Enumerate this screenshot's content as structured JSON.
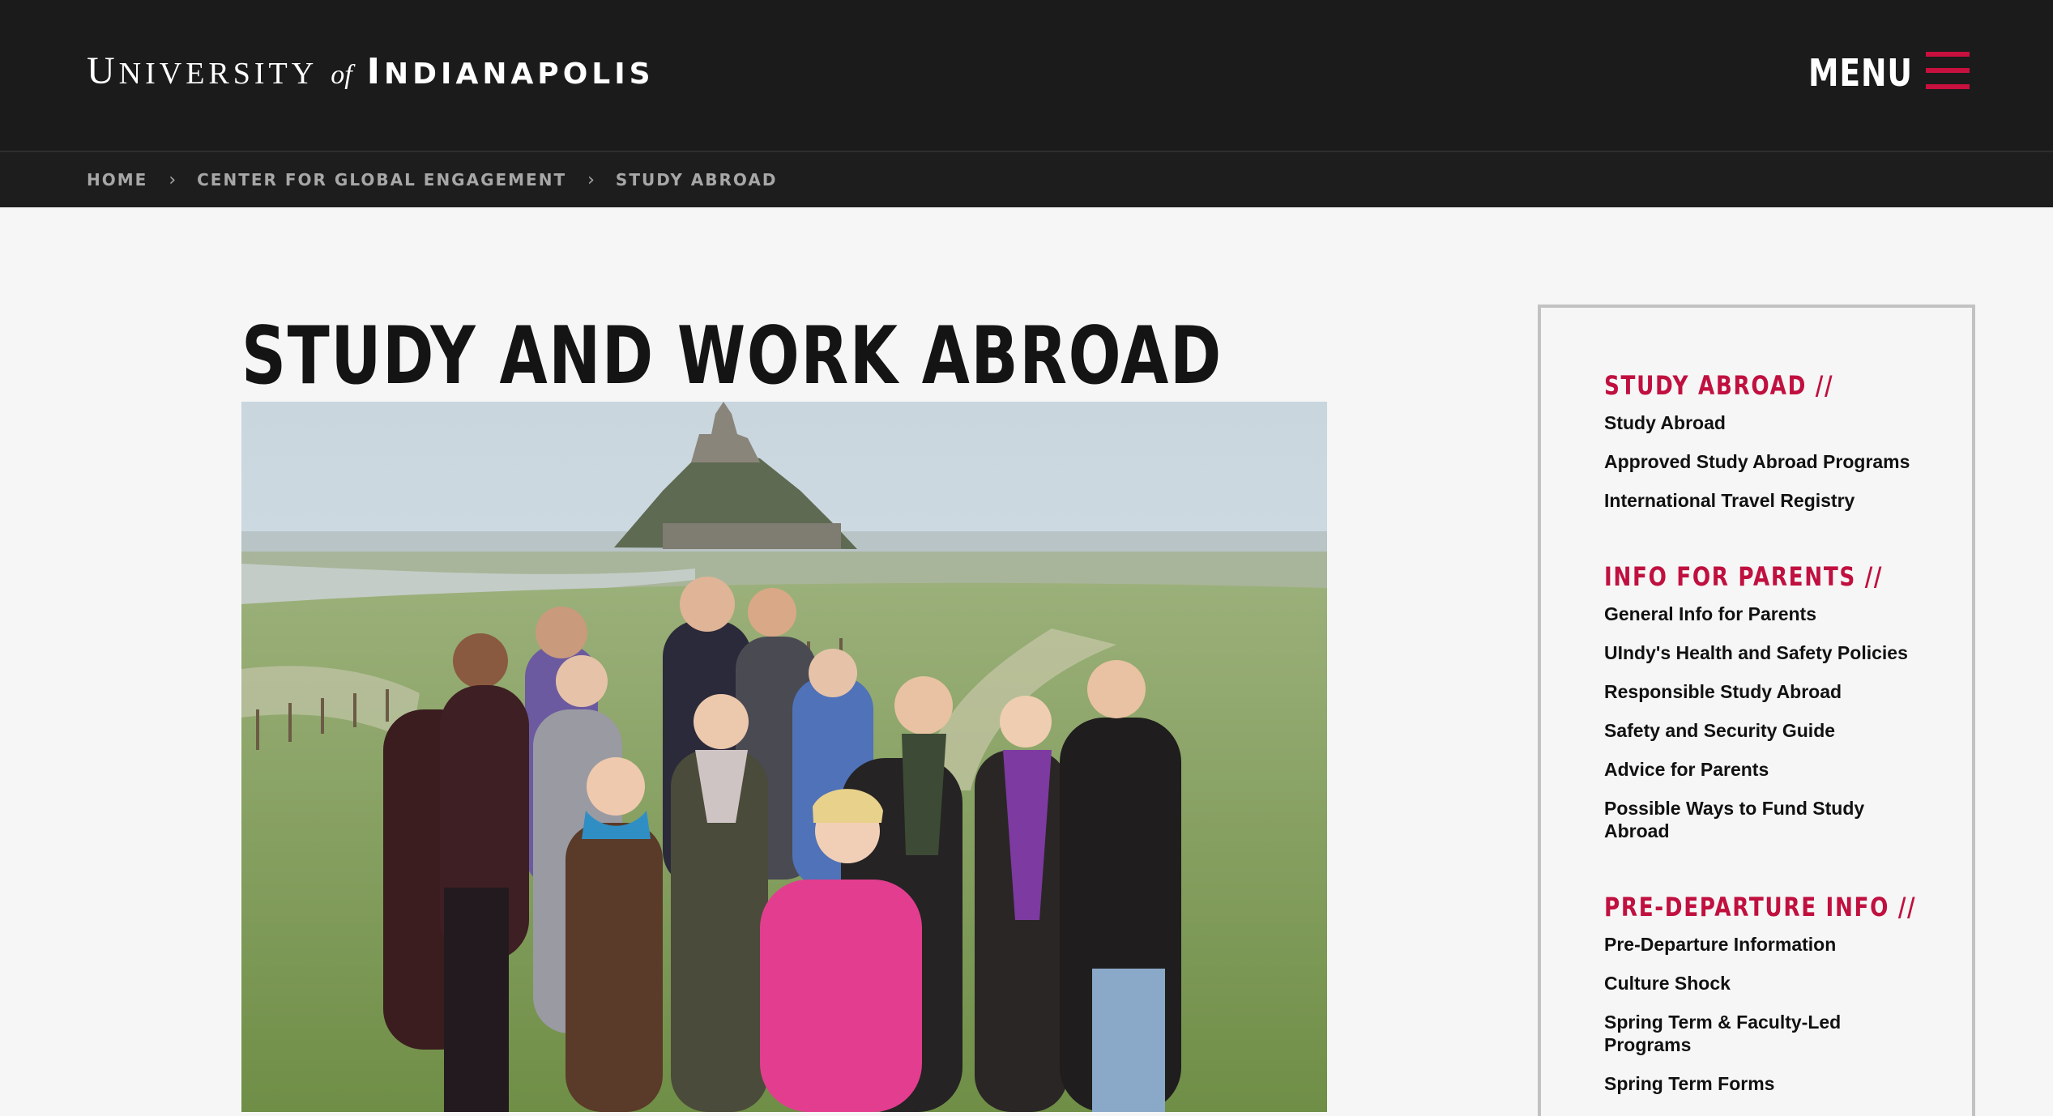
{
  "header": {
    "logo": {
      "university_initial": "U",
      "university_rest": "NIVERSITY",
      "of": "of",
      "indy_initial": "I",
      "indy_rest": "NDIANAPOLIS"
    },
    "menu_label": "MENU",
    "accent_color": "#c8103e"
  },
  "breadcrumb": [
    "HOME",
    "CENTER FOR GLOBAL ENGAGEMENT",
    "STUDY ABROAD"
  ],
  "breadcrumb_separator": "›",
  "page_title": "STUDY AND WORK ABROAD",
  "sidebar": {
    "sections": [
      {
        "title": "STUDY ABROAD //",
        "links": [
          "Study Abroad",
          "Approved Study Abroad Programs",
          "International Travel Registry"
        ]
      },
      {
        "title": "INFO FOR PARENTS //",
        "links": [
          "General Info for Parents",
          "UIndy's Health and Safety Policies",
          "Responsible Study Abroad",
          "Safety and Security Guide",
          "Advice for Parents",
          "Possible Ways to Fund Study Abroad"
        ]
      },
      {
        "title": "PRE-DEPARTURE INFO //",
        "links": [
          "Pre-Departure Information",
          "Culture Shock",
          "Spring Term & Faculty-Led Programs",
          "Spring Term Forms"
        ]
      }
    ]
  }
}
